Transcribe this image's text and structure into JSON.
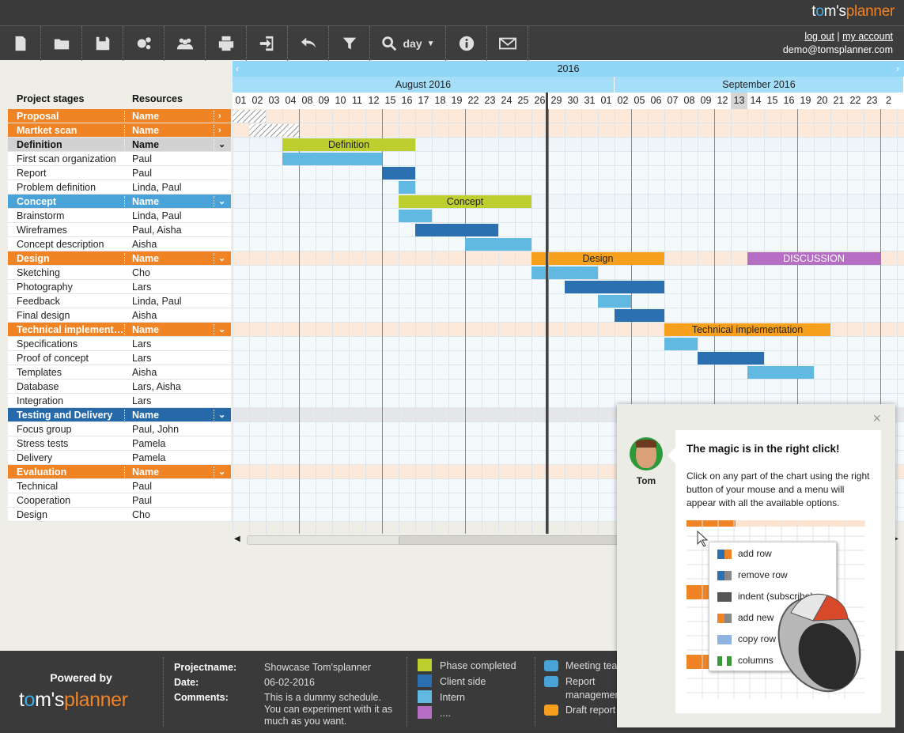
{
  "app": {
    "logo_prefix": "t",
    "logo_o": "o",
    "logo_mid": "m's",
    "logo_planner": "planner"
  },
  "toolbar": {
    "buttons": [
      "new-document-icon",
      "open-folder-icon",
      "save-icon",
      "settings-icon",
      "users-icon",
      "print-icon",
      "export-icon",
      "undo-icon",
      "filter-icon"
    ],
    "zoom_label": "day",
    "info_icon": "info-icon",
    "mail_icon": "mail-icon"
  },
  "account": {
    "logout": "log out",
    "separator": "|",
    "my_account": "my account",
    "email": "demo@tomsplanner.com"
  },
  "headers": {
    "stages": "Project stages",
    "resources": "Resources"
  },
  "timeline": {
    "year": "2016",
    "months": [
      "August 2016",
      "September 2016"
    ],
    "days": [
      "01",
      "02",
      "03",
      "04",
      "08",
      "09",
      "10",
      "11",
      "12",
      "15",
      "16",
      "17",
      "18",
      "19",
      "22",
      "23",
      "24",
      "25",
      "26",
      "29",
      "30",
      "31",
      "01",
      "02",
      "05",
      "06",
      "07",
      "08",
      "09",
      "12",
      "13",
      "14",
      "15",
      "16",
      "19",
      "20",
      "21",
      "22",
      "23",
      "2"
    ]
  },
  "rows": [
    {
      "type": "group",
      "color": "orange",
      "stage": "Proposal",
      "resource": "Name",
      "arrow": "›"
    },
    {
      "type": "group",
      "color": "orange",
      "stage": "Martket scan",
      "resource": "Name",
      "arrow": "›"
    },
    {
      "type": "group",
      "color": "gray",
      "stage": "Definition",
      "resource": "Name",
      "arrow": "⌄"
    },
    {
      "type": "task",
      "stage": "First scan organization",
      "resource": "Paul"
    },
    {
      "type": "task",
      "stage": "Report",
      "resource": "Paul"
    },
    {
      "type": "task",
      "stage": "Problem definition",
      "resource": "Linda, Paul"
    },
    {
      "type": "group",
      "color": "blue",
      "stage": "Concept",
      "resource": "Name",
      "arrow": "⌄"
    },
    {
      "type": "task",
      "stage": "Brainstorm",
      "resource": "Linda, Paul"
    },
    {
      "type": "task",
      "stage": "Wireframes",
      "resource": "Paul, Aisha"
    },
    {
      "type": "task",
      "stage": "Concept description",
      "resource": "Aisha"
    },
    {
      "type": "group",
      "color": "orange",
      "stage": "Design",
      "resource": "Name",
      "arrow": "⌄"
    },
    {
      "type": "task",
      "stage": "Sketching",
      "resource": "Cho"
    },
    {
      "type": "task",
      "stage": "Photography",
      "resource": "Lars"
    },
    {
      "type": "task",
      "stage": "Feedback",
      "resource": "Linda, Paul"
    },
    {
      "type": "task",
      "stage": "Final design",
      "resource": "Aisha"
    },
    {
      "type": "group",
      "color": "orange",
      "stage": "Technical implementation",
      "resource": "Name",
      "arrow": "⌄"
    },
    {
      "type": "task",
      "stage": "Specifications",
      "resource": "Lars"
    },
    {
      "type": "task",
      "stage": "Proof of concept",
      "resource": "Lars"
    },
    {
      "type": "task",
      "stage": "Templates",
      "resource": "Aisha"
    },
    {
      "type": "task",
      "stage": "Database",
      "resource": "Lars, Aisha"
    },
    {
      "type": "task",
      "stage": "Integration",
      "resource": "Lars"
    },
    {
      "type": "group",
      "color": "dark",
      "stage": "Testing and Delivery",
      "resource": "Name",
      "arrow": "⌄"
    },
    {
      "type": "task",
      "stage": "Focus group",
      "resource": "Paul, John"
    },
    {
      "type": "task",
      "stage": "Stress tests",
      "resource": "Pamela"
    },
    {
      "type": "task",
      "stage": "Delivery",
      "resource": "Pamela"
    },
    {
      "type": "group",
      "color": "orange",
      "stage": "Evaluation",
      "resource": "Name",
      "arrow": "⌄"
    },
    {
      "type": "task",
      "stage": "Technical",
      "resource": "Paul"
    },
    {
      "type": "task",
      "stage": "Cooperation",
      "resource": "Paul"
    },
    {
      "type": "task",
      "stage": "Design",
      "resource": "Cho"
    }
  ],
  "bars": [
    {
      "row": 2,
      "from": 3,
      "to": 10,
      "cls": "phase",
      "label": "Definition"
    },
    {
      "row": 3,
      "from": 3,
      "to": 8,
      "cls": "intern",
      "label": ""
    },
    {
      "row": 4,
      "from": 9,
      "to": 10,
      "cls": "client",
      "label": ""
    },
    {
      "row": 5,
      "from": 10,
      "to": 10,
      "cls": "intern",
      "label": ""
    },
    {
      "row": 6,
      "from": 10,
      "to": 17,
      "cls": "phase",
      "label": "Concept"
    },
    {
      "row": 7,
      "from": 10,
      "to": 11,
      "cls": "intern",
      "label": ""
    },
    {
      "row": 8,
      "from": 11,
      "to": 15,
      "cls": "client",
      "label": ""
    },
    {
      "row": 9,
      "from": 14,
      "to": 17,
      "cls": "intern",
      "label": ""
    },
    {
      "row": 10,
      "from": 18,
      "to": 25,
      "cls": "orangebar",
      "label": "Design"
    },
    {
      "row": 10,
      "from": 31,
      "to": 38,
      "cls": "purple",
      "label": "DISCUSSION"
    },
    {
      "row": 11,
      "from": 18,
      "to": 21,
      "cls": "intern",
      "label": ""
    },
    {
      "row": 12,
      "from": 20,
      "to": 25,
      "cls": "client",
      "label": ""
    },
    {
      "row": 13,
      "from": 22,
      "to": 23,
      "cls": "intern",
      "label": ""
    },
    {
      "row": 14,
      "from": 23,
      "to": 25,
      "cls": "client",
      "label": ""
    },
    {
      "row": 15,
      "from": 26,
      "to": 35,
      "cls": "orangebar",
      "label": "Technical implementation"
    },
    {
      "row": 16,
      "from": 26,
      "to": 27,
      "cls": "intern",
      "label": ""
    },
    {
      "row": 17,
      "from": 28,
      "to": 31,
      "cls": "client",
      "label": ""
    },
    {
      "row": 18,
      "from": 31,
      "to": 34,
      "cls": "intern",
      "label": ""
    }
  ],
  "bottom": {
    "powered": "Powered by",
    "info": [
      {
        "k": "Projectname:",
        "v": "Showcase Tom'splanner"
      },
      {
        "k": "Date:",
        "v": "06-02-2016"
      },
      {
        "k": "Comments:",
        "v": "This is a dummy schedule. You can experiment with it as much as you want."
      }
    ],
    "legend": [
      {
        "color": "#bccf2e",
        "label": "Phase completed"
      },
      {
        "color": "#2a6fb0",
        "label": "Client side"
      },
      {
        "color": "#61b8e0",
        "label": "Intern"
      },
      {
        "color": "#b56ec4",
        "label": "...."
      }
    ],
    "icon_legend": [
      {
        "icon": "meeting-icon",
        "label": "Meeting tear"
      },
      {
        "icon": "report-icon",
        "label": "Report"
      },
      {
        "icon": "report-icon-cont",
        "label": "managemer"
      },
      {
        "icon": "pencil-icon",
        "label": "Draft report"
      }
    ]
  },
  "popup": {
    "close": "×",
    "name": "Tom",
    "title": "The magic is in the right click!",
    "text": "Click on any part of the chart using the right button of your mouse and a menu will appear with all the available options.",
    "menu": [
      "add row",
      "remove row",
      "indent (subscribe)",
      "add new",
      "copy row",
      "columns"
    ]
  },
  "colors": {
    "orange": "#f08424",
    "blue": "#4aa3d8",
    "dark": "#2569a8",
    "phase": "#bccf2e",
    "client": "#2a6fb0",
    "intern": "#61b8e0",
    "purple": "#b56ec4"
  }
}
